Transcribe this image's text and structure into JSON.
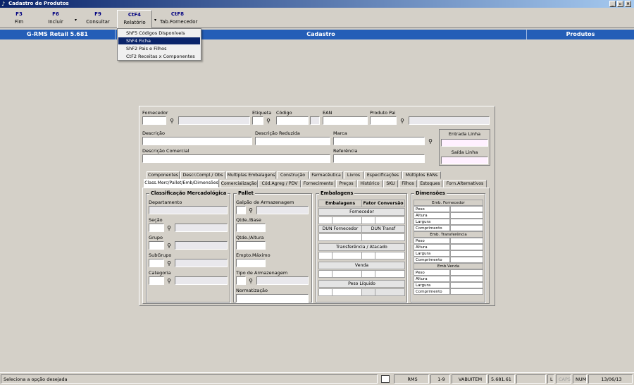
{
  "window": {
    "title": "Cadastro de Produtos"
  },
  "toolbar": [
    {
      "key": "F3",
      "label": "Fim"
    },
    {
      "key": "F6",
      "label": "Incluir"
    },
    {
      "key": "F9",
      "label": "Consultar"
    },
    {
      "key": "CtF4",
      "label": "Relatório"
    },
    {
      "key": "CtF8",
      "label": "Tab.Fornecedor"
    }
  ],
  "bluebar": {
    "system": "G-RMS Retail 5.681",
    "section": "Cadastro",
    "module": "Produtos"
  },
  "menu": [
    {
      "label": "ShF5  Códigos Disponíveis"
    },
    {
      "label": "ShF4  Ficha"
    },
    {
      "label": "ShF2  Pais e Filhos"
    },
    {
      "label": "CtF2  Receitas x Componentes"
    }
  ],
  "form": {
    "fornecedor": "Fornecedor",
    "etiqueta": "Etiqueta",
    "codigo": "Código",
    "ean": "EAN",
    "produto_pai": "Produto Pai",
    "descricao": "Descrição",
    "descricao_reduzida": "Descrição Reduzida",
    "marca": "Marca",
    "descricao_comercial": "Descrição Comercial",
    "referencia": "Referência",
    "entrada_linha": "Entrada Linha",
    "saida_linha": "Saída Linha"
  },
  "tabs_row1": [
    "Componentes",
    "Descr.Compl./ Obs",
    "Multiplas Embalagens",
    "Construção",
    "Farmacêutica",
    "Livros",
    "Especificações",
    "Múltiplos EANs"
  ],
  "tabs_row2": [
    "Class.Merc/Pallet/Emb/Dimensões",
    "Comercialização",
    "Cód.Agreg / PDV",
    "Fornecimento",
    "Preços",
    "Histórico",
    "SKU",
    "Filhos",
    "Estoques",
    "Forn.Alternativos"
  ],
  "classificacao": {
    "title": "Classificação Mercadológica",
    "departamento": "Departamento",
    "secao": "Seção",
    "grupo": "Grupo",
    "subgrupo": "SubGrupo",
    "categoria": "Categoria"
  },
  "pallet": {
    "title": "Pallet",
    "galpao": "Galpão de Armazenagem",
    "qtde_base": "Qtde./Base",
    "qtde_altura": "Qtde./Altura",
    "empto_maximo": "Empto.Máximo",
    "tipo_armazenagem": "Tipo de Armazenagem",
    "normatizacao": "Normatização"
  },
  "embalagens": {
    "title": "Embalagens",
    "col1": "Embalagens",
    "col2": "Fator Conversão",
    "fornecedor": "Fornecedor",
    "dun_fornecedor": "DUN Fornecedor",
    "dun_transf": "DUN Transf",
    "transferencia": "Transferência / Atacado",
    "venda": "Venda",
    "peso_liquido": "Peso Líquido"
  },
  "dimensoes": {
    "title": "Dimensões",
    "sections": [
      {
        "head": "Emb. Fornecedor",
        "rows": [
          "Peso",
          "Altura",
          "Largura",
          "Comprimento"
        ]
      },
      {
        "head": "Emb. Transferência",
        "rows": [
          "Peso",
          "Altura",
          "Largura",
          "Comprimento"
        ]
      },
      {
        "head": "Emb.Venda",
        "rows": [
          "Peso",
          "Altura",
          "Largura",
          "Comprimento"
        ]
      }
    ]
  },
  "status": {
    "message": "Seleciona a opção desejada",
    "user": "RMS",
    "unit": "1-9",
    "login": "VABUITEM",
    "version": "5.681.61",
    "l": "L",
    "caps": "CAPS",
    "num": "NUM",
    "date": "13/06/13"
  }
}
